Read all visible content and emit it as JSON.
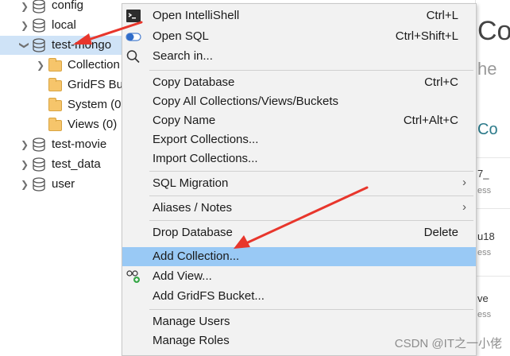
{
  "tree": {
    "items": [
      {
        "label": "config",
        "type": "db",
        "expanded": false
      },
      {
        "label": "local",
        "type": "db",
        "expanded": false
      },
      {
        "label": "test-mongo",
        "type": "db",
        "expanded": true,
        "selected": true
      },
      {
        "label": "Collection",
        "type": "folder",
        "expandable": true
      },
      {
        "label": "GridFS Bu",
        "type": "folder"
      },
      {
        "label": "System (0",
        "type": "folder"
      },
      {
        "label": "Views (0)",
        "type": "folder"
      },
      {
        "label": "test-movie",
        "type": "db",
        "expanded": false
      },
      {
        "label": "test_data",
        "type": "db",
        "expanded": false
      },
      {
        "label": "user",
        "type": "db",
        "expanded": false
      }
    ]
  },
  "menu": {
    "items": [
      {
        "label": "Open IntelliShell",
        "shortcut": "Ctrl+L",
        "icon": "terminal-icon"
      },
      {
        "label": "Open SQL",
        "shortcut": "Ctrl+Shift+L",
        "icon": "sql-toggle-icon"
      },
      {
        "label": "Search in...",
        "shortcut": "",
        "icon": "search-icon"
      },
      {
        "label": "Copy Database",
        "shortcut": "Ctrl+C"
      },
      {
        "label": "Copy All Collections/Views/Buckets",
        "shortcut": ""
      },
      {
        "label": "Copy Name",
        "shortcut": "Ctrl+Alt+C"
      },
      {
        "label": "Export Collections...",
        "shortcut": ""
      },
      {
        "label": "Import Collections...",
        "shortcut": ""
      },
      {
        "label": "SQL Migration",
        "shortcut": "",
        "submenu": true
      },
      {
        "label": "Aliases / Notes",
        "shortcut": "",
        "submenu": true
      },
      {
        "label": "Drop Database",
        "shortcut": "Delete"
      },
      {
        "label": "Add Collection...",
        "shortcut": "",
        "highlighted": true
      },
      {
        "label": "Add View...",
        "shortcut": "",
        "icon": "add-view-icon"
      },
      {
        "label": "Add GridFS Bucket...",
        "shortcut": ""
      },
      {
        "label": "Manage Users",
        "shortcut": ""
      },
      {
        "label": "Manage Roles",
        "shortcut": ""
      }
    ]
  },
  "right_panel": {
    "heading": "Co",
    "subheading": "he",
    "section": "Co",
    "rows": [
      {
        "name": "7_",
        "meta": "ess"
      },
      {
        "name": "u18",
        "meta": "ess"
      },
      {
        "name": "ve",
        "meta": "ess"
      }
    ]
  },
  "watermark": "CSDN @IT之一小佬",
  "colors": {
    "menu_highlight": "#99c9f5",
    "tree_selected": "#cfe3f7",
    "arrow": "#e8362c"
  }
}
